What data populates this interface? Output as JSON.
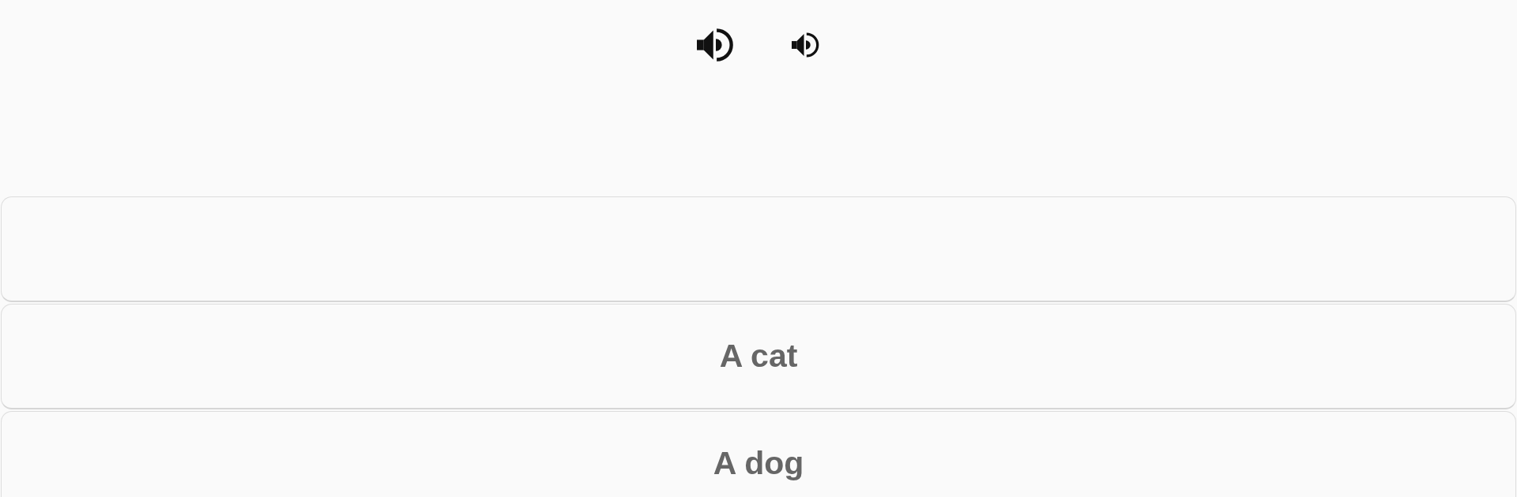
{
  "audio_buttons": [
    {
      "kind": "normal"
    },
    {
      "kind": "slow"
    }
  ],
  "options": [
    {
      "kind": "blank"
    },
    {
      "kind": "text",
      "label": "A cat"
    },
    {
      "kind": "text",
      "label": "A dog"
    }
  ]
}
